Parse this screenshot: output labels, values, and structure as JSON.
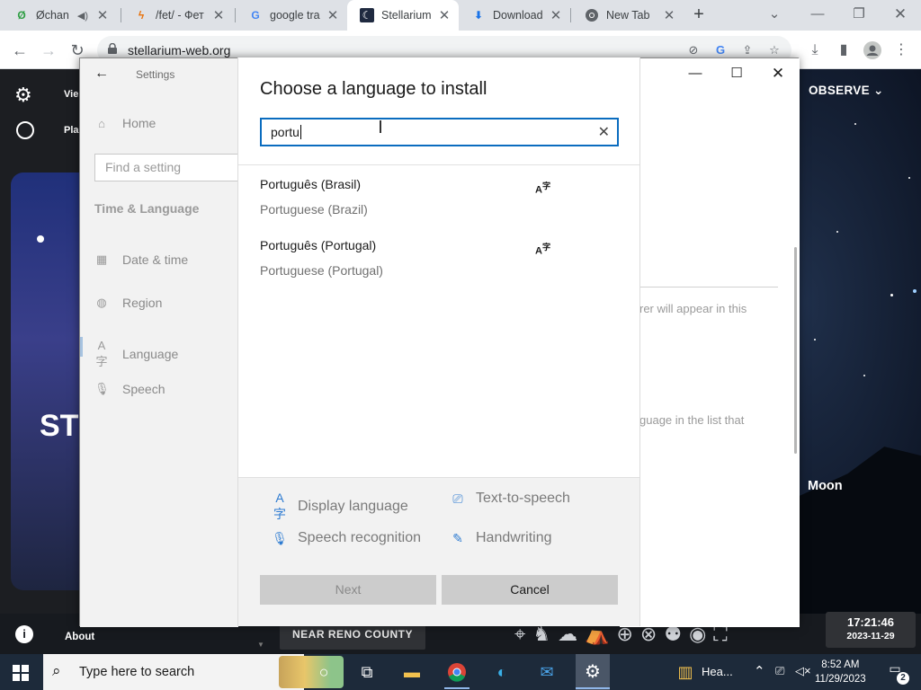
{
  "browser": {
    "tabs": [
      {
        "title": "Øchan",
        "favicon": "4chan-clover-icon",
        "audio": true
      },
      {
        "title": "/fet/ - Фет",
        "favicon": "lightning-icon"
      },
      {
        "title": "google tra",
        "favicon": "google-icon"
      },
      {
        "title": "Stellarium",
        "favicon": "stellarium-moon-icon",
        "active": true
      },
      {
        "title": "Download",
        "favicon": "download-arrow-icon"
      },
      {
        "title": "New Tab",
        "favicon": "chrome-icon"
      }
    ],
    "url": "stellarium-web.org"
  },
  "stellarium": {
    "sidebar_labels": [
      "Vie",
      "Pla"
    ],
    "hero_text": "ST",
    "observe_label": "OBSERVE",
    "moon_label": "Moon",
    "about_label": "About",
    "location": "NEAR RENO COUNTY",
    "time": "17:21:46",
    "date": "2023-11-29"
  },
  "settings": {
    "window_title": "Settings",
    "nav_home": "Home",
    "find_placeholder": "Find a setting",
    "section_title": "Time & Language",
    "nav_items": [
      {
        "label": "Date & time",
        "icon": "calendar-clock-icon"
      },
      {
        "label": "Region",
        "icon": "globe-icon"
      },
      {
        "label": "Language",
        "icon": "language-icon"
      },
      {
        "label": "Speech",
        "icon": "microphone-icon"
      }
    ],
    "right_fragments": [
      "rer will appear in this",
      "guage in the list that"
    ]
  },
  "dialog": {
    "title": "Choose a language to install",
    "search_value": "portu",
    "languages": [
      {
        "native": "Português (Brasil)",
        "english": "Portuguese (Brazil)"
      },
      {
        "native": "Português (Portugal)",
        "english": "Portuguese (Portugal)"
      }
    ],
    "features": [
      {
        "label": "Display language",
        "icon": "display-language-icon"
      },
      {
        "label": "Text-to-speech",
        "icon": "text-to-speech-icon"
      },
      {
        "label": "Speech recognition",
        "icon": "microphone-icon"
      },
      {
        "label": "Handwriting",
        "icon": "handwriting-icon"
      }
    ],
    "next_label": "Next",
    "cancel_label": "Cancel"
  },
  "taskbar": {
    "search_placeholder": "Type here to search",
    "weather_text": "Hea...",
    "time": "8:52 AM",
    "date": "11/29/2023",
    "notification_count": "2"
  }
}
